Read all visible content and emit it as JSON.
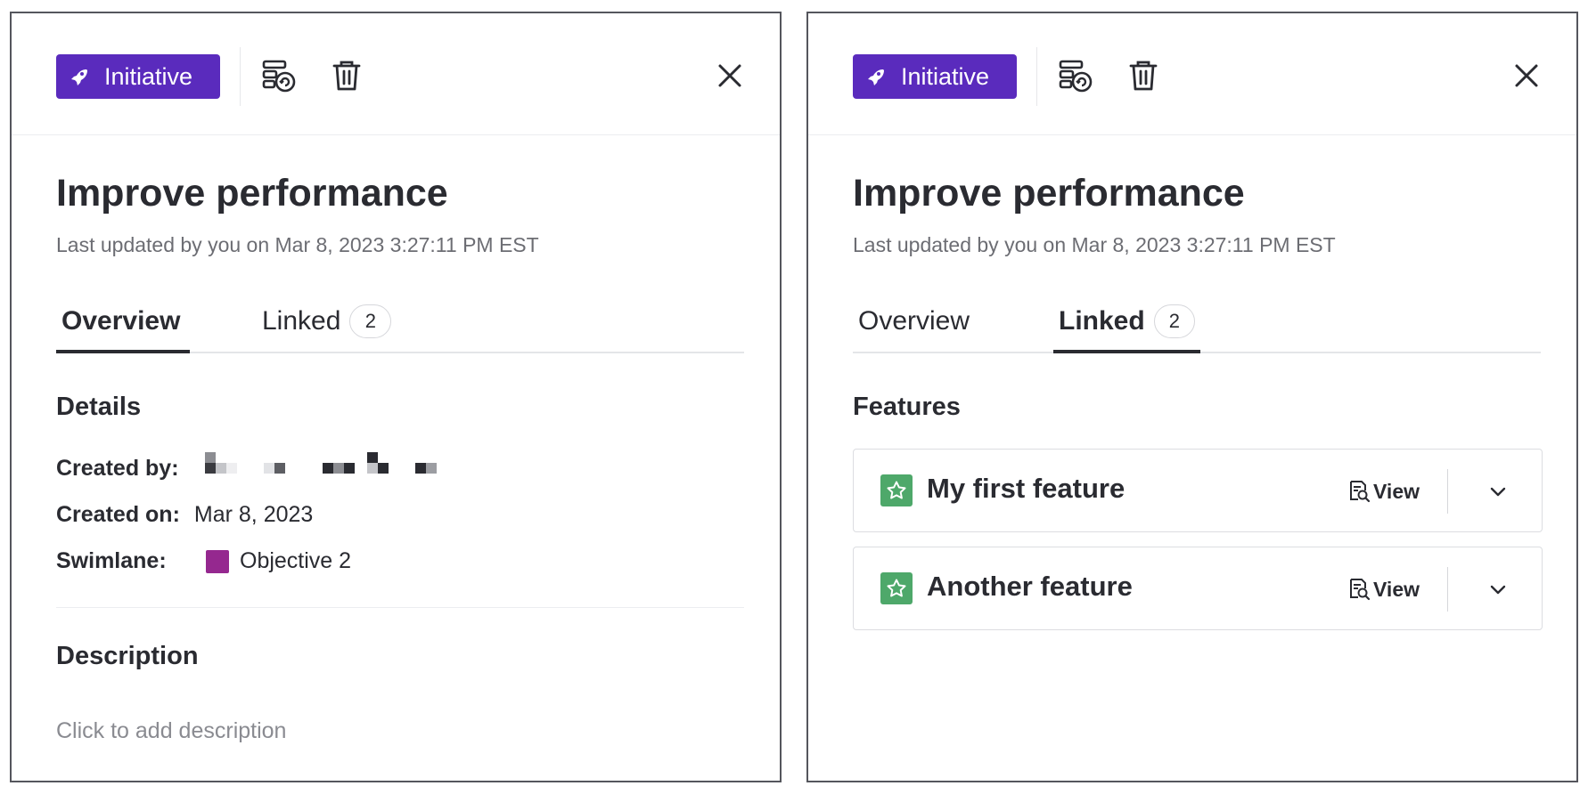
{
  "left_panel": {
    "badge_label": "Initiative",
    "title": "Improve performance",
    "last_updated": "Last updated by you on Mar 8, 2023 3:27:11 PM EST",
    "tabs": [
      {
        "label": "Overview",
        "active": true
      },
      {
        "label": "Linked",
        "count": "2",
        "active": false
      }
    ],
    "details": {
      "heading": "Details",
      "created_by_label": "Created by:",
      "created_on_label": "Created on:",
      "created_on_value": "Mar 8, 2023",
      "swimlane_label": "Swimlane:",
      "swimlane_value": "Objective 2",
      "swimlane_color": "#95288f"
    },
    "description": {
      "heading": "Description",
      "placeholder": "Click to add description"
    }
  },
  "right_panel": {
    "badge_label": "Initiative",
    "title": "Improve performance",
    "last_updated": "Last updated by you on Mar 8, 2023 3:27:11 PM EST",
    "tabs": [
      {
        "label": "Overview",
        "active": false
      },
      {
        "label": "Linked",
        "count": "2",
        "active": true
      }
    ],
    "features": {
      "heading": "Features",
      "items": [
        {
          "name": "My first feature",
          "view_label": "View"
        },
        {
          "name": "Another feature",
          "view_label": "View"
        }
      ]
    }
  },
  "colors": {
    "badge": "#5a2bbd",
    "feature_icon": "#4ea86a",
    "text": "#2a2b31"
  },
  "icons": [
    "rocket-icon",
    "convert-icon",
    "trash-icon",
    "close-icon",
    "star-icon",
    "view-icon",
    "chevron-down-icon"
  ]
}
